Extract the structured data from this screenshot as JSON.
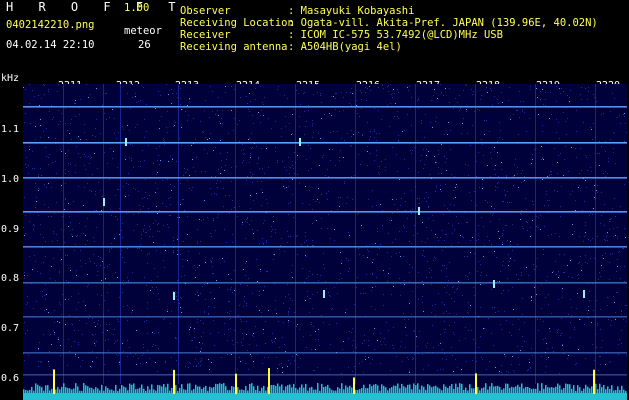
{
  "header": {
    "app_title": "H R O F F T",
    "app_version": "1.00",
    "file_name": "0402142210.png",
    "meteor_label": "meteor",
    "datetime": "04.02.14 22:10",
    "meteor_count": "26"
  },
  "metadata": {
    "rows": [
      {
        "label": "Observer",
        "value": ": Masayuki Kobayashi"
      },
      {
        "label": "Receiving Location",
        "value": ": Ogata-vill. Akita-Pref. JAPAN (139.96E, 40.02N)"
      },
      {
        "label": "Receiver",
        "value": ": ICOM IC-575 53.7492(@LCD)MHz USB"
      },
      {
        "label": "Receiving antenna",
        "value": ": A504HB(yagi 4el)"
      }
    ]
  },
  "spectrogram": {
    "y_unit": "kHz",
    "y_ticks": [
      "1.1",
      "1.0",
      "0.9",
      "0.8",
      "0.7",
      "0.6"
    ],
    "x_ticks": [
      "2211",
      "2212",
      "2213",
      "2214",
      "2215",
      "2216",
      "2217",
      "2218",
      "2219",
      "2220"
    ],
    "colors": {
      "background": "#00003a",
      "noise": "#1a2fa8",
      "signal": "#5aa0ff",
      "bright": "#9af0ff",
      "meteor": "#ffff40",
      "trace_fill": "#22c0d0"
    }
  }
}
